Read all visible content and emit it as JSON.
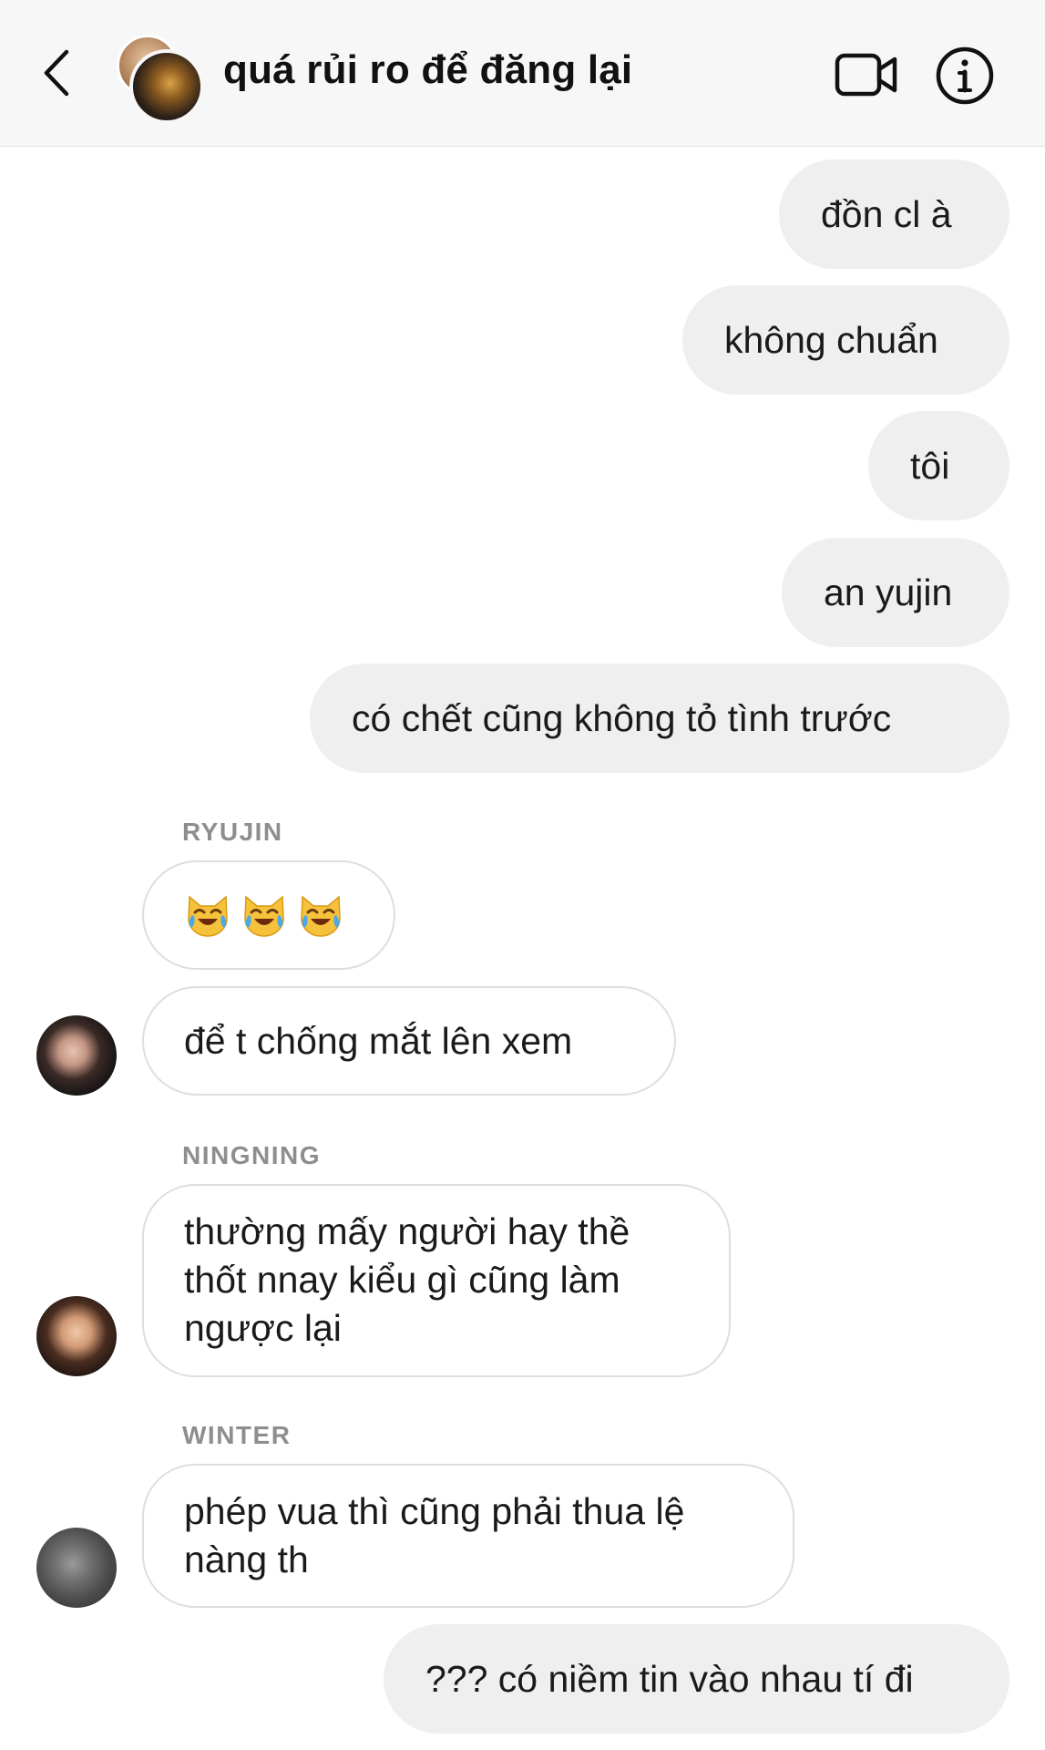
{
  "header": {
    "title": "quá rủi ro để đăng lại",
    "back_icon": "chevron-left-icon",
    "video_icon": "video-camera-icon",
    "info_icon": "info-icon"
  },
  "messages": [
    {
      "side": "out",
      "text": "đồn cl à"
    },
    {
      "side": "out",
      "text": "không chuẩn"
    },
    {
      "side": "out",
      "text": "tôi"
    },
    {
      "side": "out",
      "text": "an yujin"
    },
    {
      "side": "out",
      "text": "có chết cũng không tỏ tình trước"
    },
    {
      "side": "in",
      "sender": "RYUJIN",
      "emoji": [
        "😹",
        "😹",
        "😹"
      ]
    },
    {
      "side": "in",
      "text": "để t chống mắt lên xem"
    },
    {
      "side": "in",
      "sender": "NINGNING",
      "lines": [
        "thường mấy người hay thề",
        "thốt nnay kiểu gì cũng làm",
        "ngược lại"
      ]
    },
    {
      "side": "in",
      "sender": "WINTER",
      "lines": [
        "phép vua thì cũng phải thua lệ",
        "nàng th"
      ]
    },
    {
      "side": "out",
      "text": "??? có niềm tin vào nhau tí đi"
    }
  ],
  "colors": {
    "outgoing_bubble": "#efefef",
    "incoming_border": "#dedede",
    "sender_label": "#8e8e8e"
  }
}
